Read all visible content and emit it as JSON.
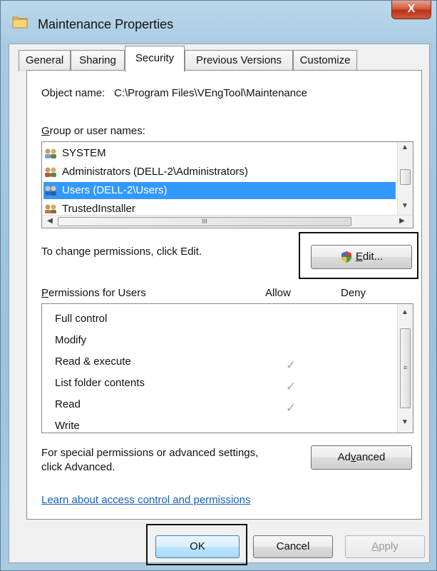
{
  "window": {
    "title": "Maintenance Properties",
    "close_label": "X"
  },
  "tabs": [
    {
      "label": "General",
      "active": false
    },
    {
      "label": "Sharing",
      "active": false
    },
    {
      "label": "Security",
      "active": true
    },
    {
      "label": "Previous Versions",
      "active": false
    },
    {
      "label": "Customize",
      "active": false
    }
  ],
  "security": {
    "object_name_label": "Object name:",
    "object_name_value": "C:\\Program Files\\VEngTool\\Maintenance",
    "group_label": "Group or user names:",
    "users": [
      {
        "name": "SYSTEM",
        "selected": false
      },
      {
        "name": "Administrators (DELL-2\\Administrators)",
        "selected": false
      },
      {
        "name": "Users (DELL-2\\Users)",
        "selected": true
      },
      {
        "name": "TrustedInstaller",
        "selected": false
      }
    ],
    "hscroll_grip": "III",
    "change_text": "To change permissions, click Edit.",
    "edit_button": "Edit...",
    "permissions_label": "Permissions for Users",
    "allow_header": "Allow",
    "deny_header": "Deny",
    "permissions": [
      {
        "name": "Full control",
        "allow": false,
        "deny": false
      },
      {
        "name": "Modify",
        "allow": false,
        "deny": false
      },
      {
        "name": "Read & execute",
        "allow": true,
        "deny": false
      },
      {
        "name": "List folder contents",
        "allow": true,
        "deny": false
      },
      {
        "name": "Read",
        "allow": true,
        "deny": false
      },
      {
        "name": "Write",
        "allow": false,
        "deny": false
      }
    ],
    "check_glyph": "✓",
    "special_line1": "For special permissions or advanced settings,",
    "special_line2": "click Advanced.",
    "advanced_button": "Advanced",
    "learn_link": "Learn about access control and permissions"
  },
  "footer": {
    "ok": "OK",
    "cancel": "Cancel",
    "apply": "Apply"
  },
  "colors": {
    "selection": "#3399ff",
    "link": "#1a5fb4",
    "close": "#c7432a"
  }
}
